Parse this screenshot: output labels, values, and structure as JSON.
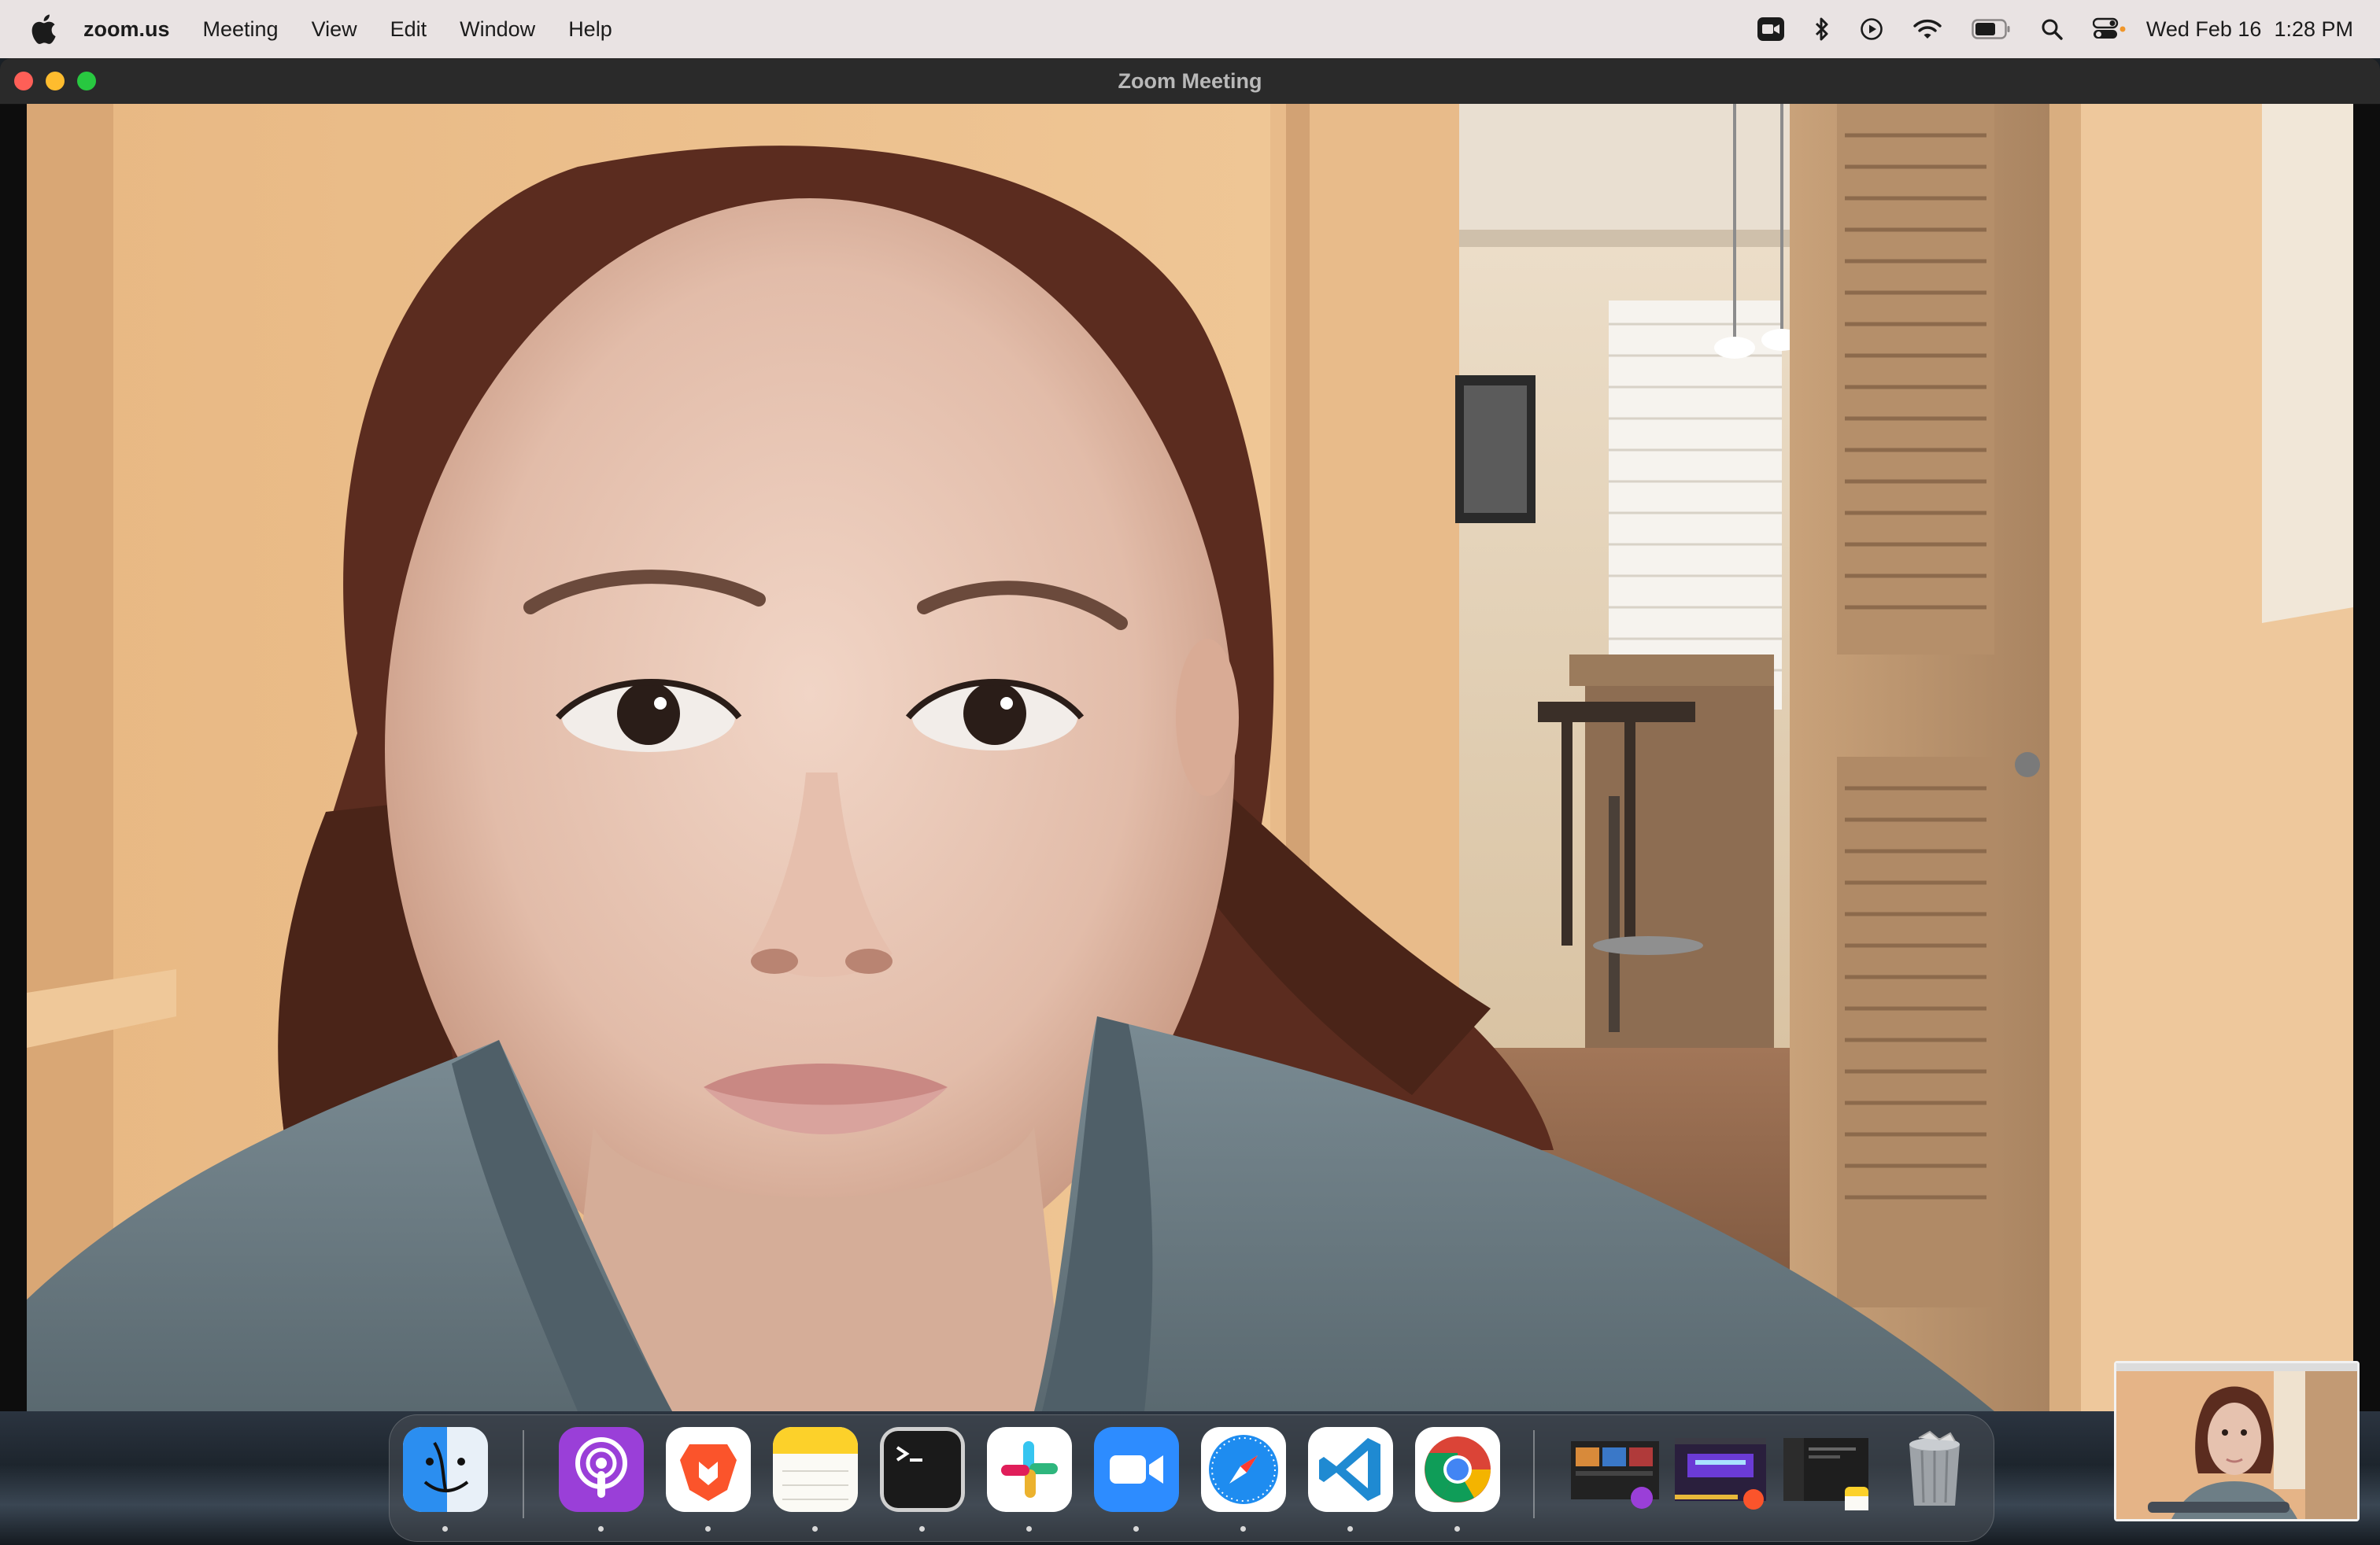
{
  "menubar": {
    "app_name": "zoom.us",
    "items": [
      "Meeting",
      "View",
      "Edit",
      "Window",
      "Help"
    ],
    "status_icons": [
      "zoom-camera-icon",
      "bluetooth-icon",
      "now-playing-icon",
      "wifi-icon",
      "battery-icon",
      "spotlight-search-icon",
      "control-center-icon"
    ],
    "date": "Wed Feb 16",
    "time": "1:28 PM"
  },
  "window": {
    "title": "Zoom Meeting",
    "traffic_colors": {
      "close": "#fe5f57",
      "minimize": "#febc2e",
      "maximize": "#28c840"
    }
  },
  "dock": {
    "apps": [
      "Finder",
      "Podcasts",
      "Brave Browser",
      "Notes",
      "Terminal",
      "Slack",
      "zoom.us",
      "Safari",
      "Visual Studio Code",
      "Google Chrome"
    ],
    "minimized_windows": [
      "Podcasts window",
      "Brave Browser window",
      "Notes window"
    ],
    "trash": "Trash"
  }
}
